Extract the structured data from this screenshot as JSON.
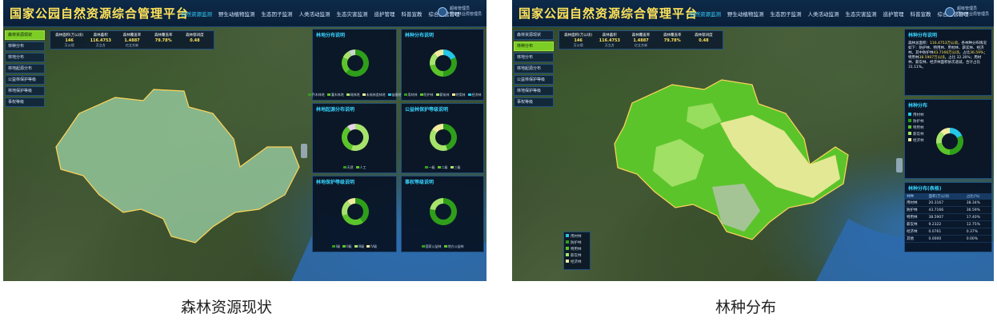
{
  "left": {
    "brand": "国家公园自然资源综合管理平台",
    "nav": [
      "自然资源监测",
      "野生动植物监测",
      "生态因子监测",
      "人类活动监测",
      "生态灾害监测",
      "巡护管理",
      "科普宣教",
      "综合运营管理"
    ],
    "nav_active_index": 0,
    "user": {
      "name": "超级管理员",
      "sub": "国家林业局管理员"
    },
    "menu": [
      "森林资源现状",
      "林种分布",
      "林地分布",
      "林地起源分布",
      "公益林保护等级",
      "林地保护等级",
      "事权等级"
    ],
    "menu_active_index": 0,
    "stats": [
      {
        "label": "森林面积(万公顷)",
        "value": "146",
        "unit": "万公顷"
      },
      {
        "label": "森林蓄积",
        "value": "116.4753",
        "unit": "万立方"
      },
      {
        "label": "森林覆盖率",
        "value": "1.4887",
        "unit": "亿立方米"
      },
      {
        "label": "森林覆盖率",
        "value": "79.78%",
        "unit": ""
      },
      {
        "label": "森林郁闭度",
        "value": "0.48",
        "unit": ""
      }
    ],
    "panels": [
      {
        "title": "林地分布说明",
        "legend": [
          "乔木林地",
          "灌木林地",
          "疏林地",
          "未成林造林地",
          "苗圃地"
        ]
      },
      {
        "title": "林种分布说明",
        "legend": [
          "用材林",
          "防护林",
          "薪炭林",
          "特用林",
          "经济林"
        ]
      },
      {
        "title": "林地起源分布说明",
        "legend": [
          "天然",
          "人工"
        ]
      },
      {
        "title": "公益林保护等级说明",
        "legend": [
          "一级",
          "二级",
          "三级"
        ]
      },
      {
        "title": "林地保护等级说明",
        "legend": [
          "I级",
          "II级",
          "III级",
          "IV级"
        ]
      },
      {
        "title": "事权等级说明",
        "legend": [
          "国家公益林",
          "地方公益林"
        ]
      }
    ],
    "caption": "森林资源现状"
  },
  "right": {
    "brand": "国家公园自然资源综合管理平台",
    "nav": [
      "自然资源监测",
      "野生动植物监测",
      "生态因子监测",
      "人类活动监测",
      "生态灾害监测",
      "巡护管理",
      "科普宣教",
      "综合运营管理"
    ],
    "nav_active_index": 0,
    "user": {
      "name": "超级管理员",
      "sub": "国家林业局管理员"
    },
    "menu": [
      "森林资源现状",
      "林种分布",
      "林地分布",
      "林地起源分布",
      "公益林保护等级",
      "林地保护等级",
      "事权等级"
    ],
    "menu_active_index": 1,
    "stats": [
      {
        "label": "森林面积(万公顷)",
        "value": "146",
        "unit": "万公顷"
      },
      {
        "label": "森林蓄积",
        "value": "116.4753",
        "unit": "万立方"
      },
      {
        "label": "森林覆盖率",
        "value": "1.4887",
        "unit": "亿立方米"
      },
      {
        "label": "森林覆盖率",
        "value": "79.78%",
        "unit": ""
      },
      {
        "label": "森林郁闭度",
        "value": "0.48",
        "unit": ""
      }
    ],
    "info_title": "林种分布说明",
    "info_text_1": "森林总面积：",
    "info_hl_1": "116.4753万公顷",
    "info_text_2": "，各林种分布情况如下：防护林、特用林、用材林、薪炭林、经济林。其中防护林",
    "info_hl_2": "43.7166万公顷",
    "info_text_3": "，占比",
    "info_hl_3": "36.59%",
    "info_text_4": "；特用林",
    "info_hl_4": "38.5907万公顷",
    "info_text_5": "，占比 32.30%；用材林、薪炭林、经济林面积依次递减，合计占比 31.11%。",
    "chart_title": "林种分布",
    "chart_legend": [
      "用材林",
      "防护林",
      "特用林",
      "薪炭林",
      "经济林"
    ],
    "table_title": "林种分布(表格)",
    "table_headers": [
      "林种",
      "面积(万公顷)",
      "占比(%)"
    ],
    "table_rows": [
      [
        "用材林",
        "20.3167",
        "38.34%"
      ],
      [
        "防护林",
        "43.7166",
        "36.59%"
      ],
      [
        "特用林",
        "38.5907",
        "17.40%"
      ],
      [
        "薪炭林",
        "9.2322",
        "12.75%"
      ],
      [
        "经济林",
        "0.0761",
        "0.37%"
      ],
      [
        "其他",
        "0.0000",
        "0.00%"
      ]
    ],
    "map_legend": [
      "用材林",
      "防护林",
      "特用林",
      "薪炭林",
      "经济林"
    ],
    "caption": "林种分布"
  },
  "colors": {
    "brand": "#ffe25a",
    "accent": "#37d2ff",
    "green_dark": "#2f9e1a",
    "green_mid": "#5cc42b",
    "green_light": "#a6e36b",
    "yellow_pale": "#f2eca0",
    "cyan": "#26c6e6"
  }
}
